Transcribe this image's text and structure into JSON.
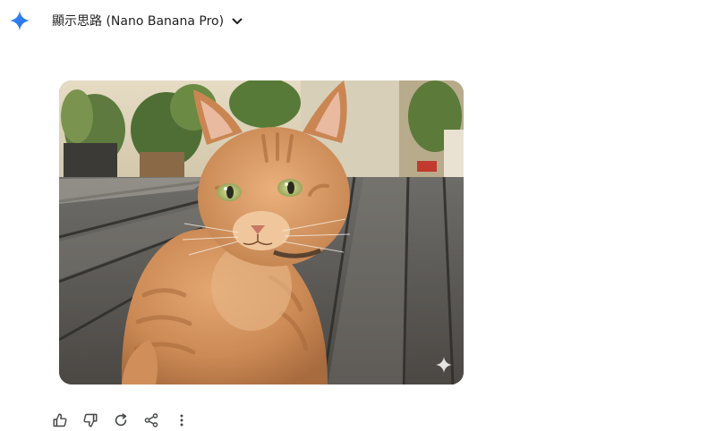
{
  "header": {
    "logo_icon": "gemini-sparkle-icon",
    "thoughts_label": "顯示思路 (Nano Banana Pro)",
    "toggle_icon": "chevron-down-icon"
  },
  "image": {
    "subject": "orange tabby cat on wooden deck",
    "corner_icon": "sparkle-icon"
  },
  "actions": [
    {
      "icon": "thumbs-up-icon"
    },
    {
      "icon": "thumbs-down-icon"
    },
    {
      "icon": "regenerate-icon"
    },
    {
      "icon": "share-icon"
    },
    {
      "icon": "more-vertical-icon"
    }
  ],
  "colors": {
    "accent": "#4285f4",
    "text": "#1f1f1f",
    "icon": "#444746"
  }
}
